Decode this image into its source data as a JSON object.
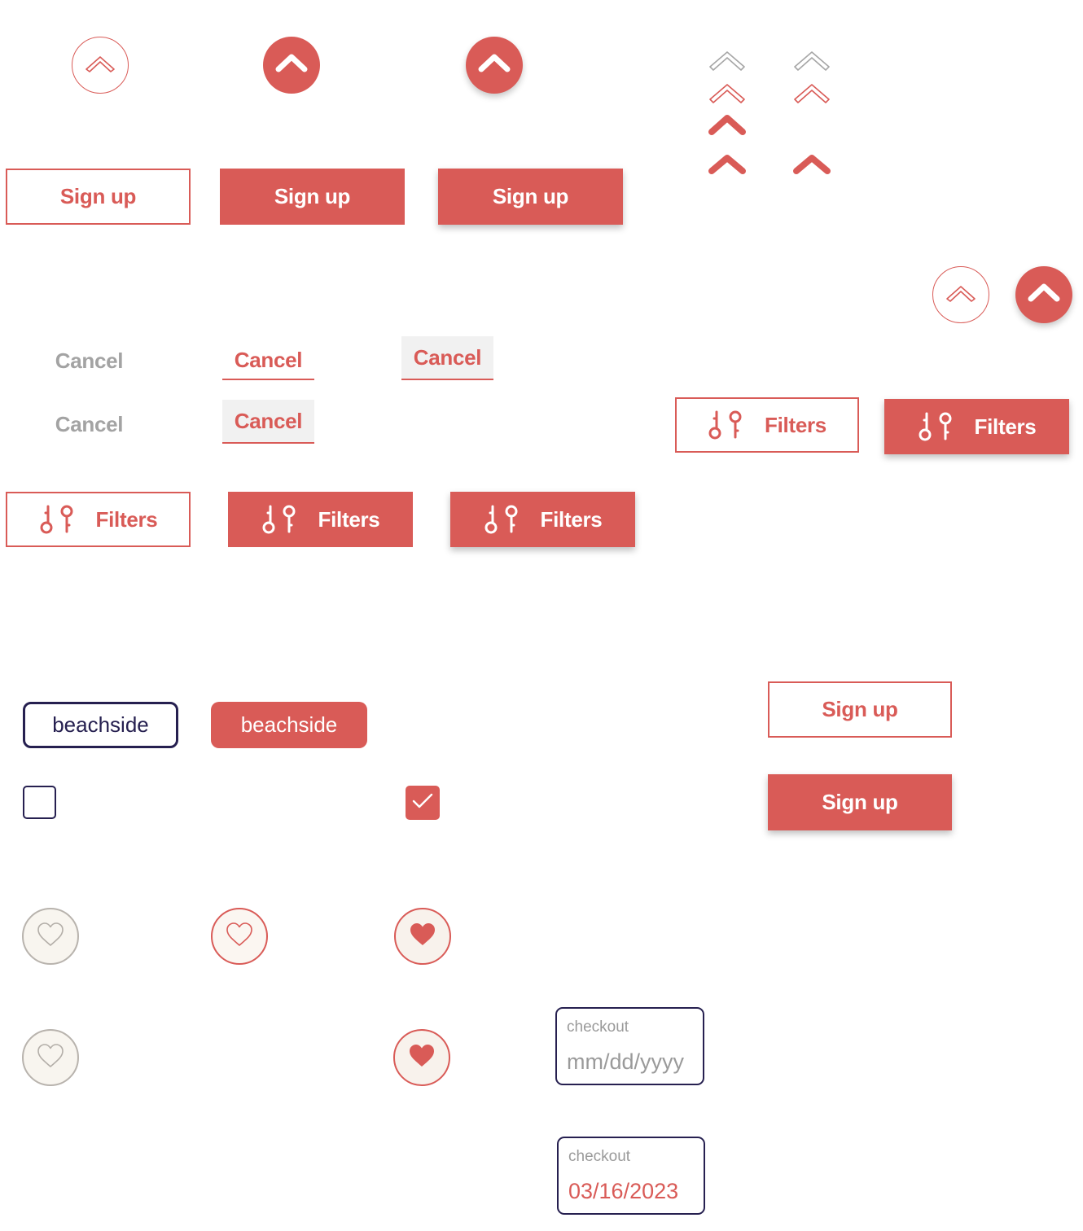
{
  "colors": {
    "accent": "#d95b57",
    "navy": "#262050",
    "muted": "#a3a3a3",
    "light_bg": "#f1f1f1"
  },
  "icons": {
    "chevron": "chevron-up-icon",
    "filter": "sliders-filter-icon",
    "heart": "heart-icon",
    "check": "check-icon"
  },
  "buttons": {
    "signup_label": "Sign up",
    "cancel_label": "Cancel",
    "filters_label": "Filters"
  },
  "chips": {
    "outline_label": "beachside",
    "filled_label": "beachside"
  },
  "date_fields": [
    {
      "label": "checkout",
      "placeholder": "mm/dd/yyyy",
      "value": ""
    },
    {
      "label": "checkout",
      "placeholder": "",
      "value": "03/16/2023"
    }
  ]
}
